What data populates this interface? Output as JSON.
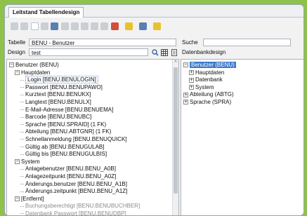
{
  "window": {
    "tab_label": "Leitstand Tabellendesign"
  },
  "toolbar": {
    "icons": [
      "search-icon",
      "table-icon",
      "page-icon",
      "record-icon",
      "open-icon",
      "grid-icon",
      "list-icon",
      "arrow-up-icon",
      "arrow-down-icon",
      "refresh-icon",
      "save-icon",
      "pen-icon",
      "paint-icon",
      "favorite-icon"
    ]
  },
  "form": {
    "tabelle_label": "Tabelle",
    "tabelle_value": "BENU - Benutzer",
    "design_label": "Design",
    "design_value": "test",
    "suche_label": "Suche",
    "suche_value": "",
    "datenbankdesign_label": "Datenbankdesign"
  },
  "left_tree": {
    "items": [
      {
        "text": "Benutzer (BENU)",
        "exp": "minus",
        "level": 0
      },
      {
        "text": "Hauptdaten",
        "exp": "minus",
        "level": 1
      },
      {
        "text": "Login [BENU.BENULOGIN]",
        "exp": "",
        "level": 2,
        "selected": true
      },
      {
        "text": "Passwort [BENU.BENUPAWO]",
        "exp": "",
        "level": 2
      },
      {
        "text": "Kurztext [BENU.BENUKX]",
        "exp": "",
        "level": 2
      },
      {
        "text": "Langtext [BENU.BENULX]",
        "exp": "",
        "level": 2
      },
      {
        "text": "E-Mail-Adresse [BENU.BENUEMA]",
        "exp": "",
        "level": 2
      },
      {
        "text": "Barcode [BENU.BENUBC]",
        "exp": "",
        "level": 2
      },
      {
        "text": "Sprache [BENU.SPRAID] (1 FK)",
        "exp": "",
        "level": 2
      },
      {
        "text": "Abteilung [BENU.ABTGNR] (1 FK)",
        "exp": "",
        "level": 2
      },
      {
        "text": "Schnellanmeldung [BENU.BENUQUICK]",
        "exp": "",
        "level": 2
      },
      {
        "text": "Gültig ab [BENU.BENUGULAB]",
        "exp": "",
        "level": 2
      },
      {
        "text": "Gültig bis [BENU.BENUGULBIS]",
        "exp": "",
        "level": 2
      },
      {
        "text": "System",
        "exp": "minus",
        "level": 1
      },
      {
        "text": "Anlagebenutzer [BENU.BENU_A0B]",
        "exp": "",
        "level": 2
      },
      {
        "text": "Anlagezeitpunkt [BENU.BENU_A0Z]",
        "exp": "",
        "level": 2
      },
      {
        "text": "Änderungs.benutzer [BENU.BENU_A1B]",
        "exp": "",
        "level": 2
      },
      {
        "text": "Änderungs.zeitpunkt [BENU.BENU_A1Z]",
        "exp": "",
        "level": 2
      },
      {
        "text": "[Entfernt]",
        "exp": "minus",
        "level": 1
      },
      {
        "text": "Buchungsberechtigt [BENU.BENUBUCHBER]",
        "exp": "",
        "level": 2,
        "grey": true
      },
      {
        "text": "Datenbank Passwort [BENU.BENUDBP]",
        "exp": "",
        "level": 2,
        "grey": true
      }
    ]
  },
  "right_tree": {
    "items": [
      {
        "text": "Benutzer (BENU)",
        "exp": "minus",
        "level": 0,
        "selected": true
      },
      {
        "text": "Hauptdaten",
        "exp": "plus",
        "level": 1
      },
      {
        "text": "Datenbank",
        "exp": "plus",
        "level": 1
      },
      {
        "text": "System",
        "exp": "plus",
        "level": 1
      },
      {
        "text": "Abteilung (ABTG)",
        "exp": "plus",
        "level": 0
      },
      {
        "text": "Sprache (SPRA)",
        "exp": "plus",
        "level": 0
      }
    ]
  },
  "scrollbar": {
    "up_arrow": "^",
    "down_arrow": "v"
  }
}
